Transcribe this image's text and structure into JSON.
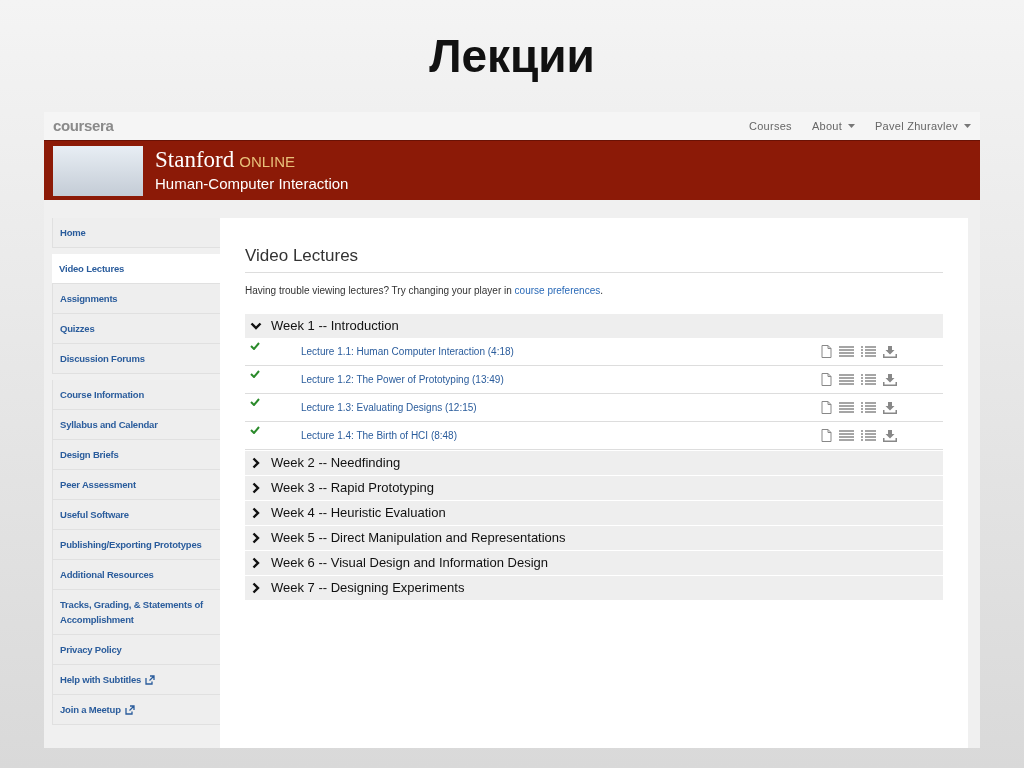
{
  "slide_title": "Лекции",
  "topbar": {
    "logo": "coursera",
    "links": [
      {
        "label": "Courses",
        "dropdown": false
      },
      {
        "label": "About",
        "dropdown": true
      },
      {
        "label": "Pavel Zhuravlev",
        "dropdown": true
      }
    ]
  },
  "banner": {
    "brand": "Stanford",
    "brand_suffix": "ONLINE",
    "course": "Human-Computer Interaction"
  },
  "sidebar": {
    "groups": [
      [
        {
          "label": "Home",
          "selected": false,
          "external": false
        }
      ],
      [
        {
          "label": "Video Lectures",
          "selected": true,
          "external": false
        },
        {
          "label": "Assignments",
          "selected": false,
          "external": false
        },
        {
          "label": "Quizzes",
          "selected": false,
          "external": false
        },
        {
          "label": "Discussion Forums",
          "selected": false,
          "external": false
        }
      ],
      [
        {
          "label": "Course Information",
          "selected": false,
          "external": false
        },
        {
          "label": "Syllabus and Calendar",
          "selected": false,
          "external": false
        },
        {
          "label": "Design Briefs",
          "selected": false,
          "external": false
        },
        {
          "label": "Peer Assessment",
          "selected": false,
          "external": false
        },
        {
          "label": "Useful Software",
          "selected": false,
          "external": false
        },
        {
          "label": "Publishing/Exporting Prototypes",
          "selected": false,
          "external": false
        },
        {
          "label": "Additional Resources",
          "selected": false,
          "external": false
        },
        {
          "label": "Tracks, Grading, & Statements of Accomplishment",
          "selected": false,
          "external": false
        },
        {
          "label": "Privacy Policy",
          "selected": false,
          "external": false
        },
        {
          "label": "Help with Subtitles",
          "selected": false,
          "external": true
        },
        {
          "label": "Join a Meetup",
          "selected": false,
          "external": true
        }
      ]
    ]
  },
  "main": {
    "heading": "Video Lectures",
    "notice": "Having trouble viewing lectures? Try changing your player in ",
    "notice_link": "course preferences",
    "notice_end": ".",
    "weeks": [
      {
        "title": "Week 1 -- Introduction",
        "expanded": true,
        "lectures": [
          {
            "title": "Lecture 1.1: Human Computer Interaction (4:18)",
            "watched": true
          },
          {
            "title": "Lecture 1.2: The Power of Prototyping (13:49)",
            "watched": true
          },
          {
            "title": "Lecture 1.3: Evaluating Designs (12:15)",
            "watched": true
          },
          {
            "title": "Lecture 1.4: The Birth of HCI (8:48)",
            "watched": true
          }
        ]
      },
      {
        "title": "Week 2 -- Needfinding",
        "expanded": false
      },
      {
        "title": "Week 3 -- Rapid Prototyping",
        "expanded": false
      },
      {
        "title": "Week 4 -- Heuristic Evaluation",
        "expanded": false
      },
      {
        "title": "Week 5 -- Direct Manipulation and Representations",
        "expanded": false
      },
      {
        "title": "Week 6 -- Visual Design and Information Design",
        "expanded": false
      },
      {
        "title": "Week 7 -- Designing Experiments",
        "expanded": false
      }
    ]
  }
}
